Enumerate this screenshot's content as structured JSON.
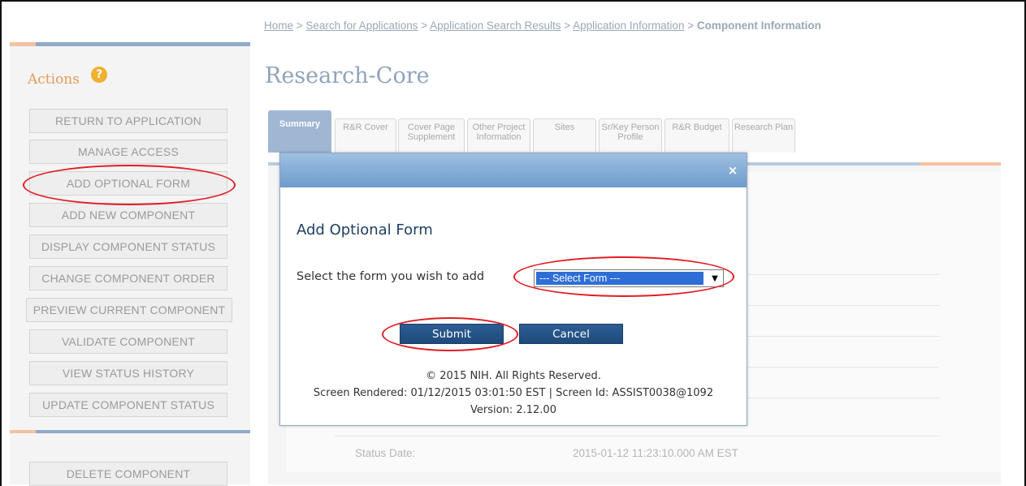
{
  "breadcrumb": {
    "home": "Home",
    "sep": " > ",
    "search": "Search for Applications",
    "results": "Application Search Results",
    "app_info": "Application Information",
    "current": "Component Information"
  },
  "page": {
    "title": "Research-Core"
  },
  "sidebar": {
    "title": "Actions",
    "help_glyph": "?",
    "buttons": [
      "RETURN TO APPLICATION",
      "MANAGE ACCESS",
      "ADD OPTIONAL FORM",
      "ADD NEW COMPONENT",
      "DISPLAY COMPONENT STATUS",
      "CHANGE COMPONENT ORDER",
      "PREVIEW CURRENT COMPONENT",
      "VALIDATE COMPONENT",
      "VIEW STATUS HISTORY",
      "UPDATE COMPONENT STATUS"
    ],
    "delete_button": "DELETE COMPONENT"
  },
  "tabs": [
    {
      "label": "Summary",
      "active": true
    },
    {
      "label": "R&R Cover"
    },
    {
      "label": "Cover Page Supplement"
    },
    {
      "label": "Other Project Information"
    },
    {
      "label": "Sites"
    },
    {
      "label": "Sr/Key Person Profile"
    },
    {
      "label": "R&R Budget"
    },
    {
      "label": "Research Plan"
    }
  ],
  "status": {
    "label": "Status Date:",
    "value": "2015-01-12 11:23:10.000 AM EST"
  },
  "modal": {
    "title": "Add Optional Form",
    "close_glyph": "×",
    "prompt": "Select the form you wish to add",
    "select_value": "--- Select Form ---",
    "select_arrow": "▼",
    "submit_label": "Submit",
    "cancel_label": "Cancel",
    "footer": {
      "copyright": "© 2015 NIH. All Rights Reserved.",
      "rendered": "Screen Rendered: 01/12/2015 03:01:50 EST | Screen Id: ASSIST0038@1092",
      "version": "Version: 2.12.00"
    }
  },
  "colors": {
    "header_blue": "#7fa6d0",
    "title_navy": "#1f3f63",
    "button_navy": "#275486",
    "highlight_red": "#e11d24",
    "actions_orange": "#e39a59"
  }
}
